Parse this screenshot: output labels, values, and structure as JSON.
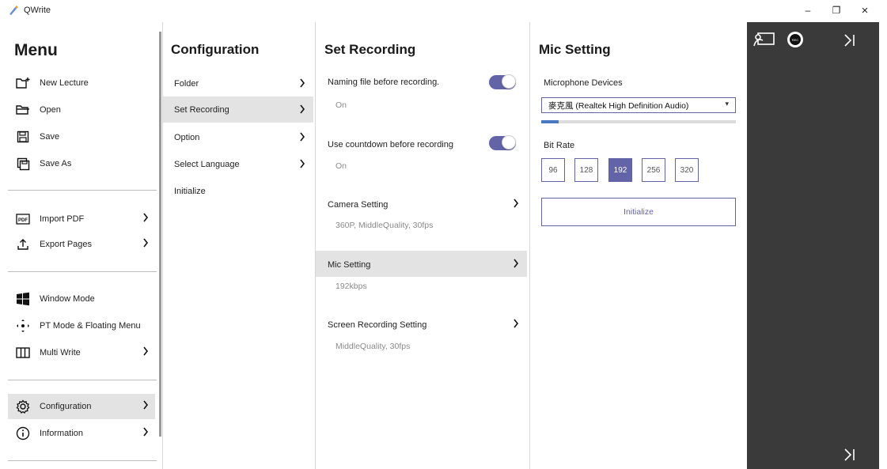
{
  "window": {
    "title": "QWrite",
    "controls": {
      "minimize": "–",
      "restore": "❐",
      "close": "×"
    }
  },
  "menu": {
    "heading": "Menu",
    "items": [
      {
        "label": "New Lecture",
        "icon": "new-lecture-icon"
      },
      {
        "label": "Open",
        "icon": "folder-open-icon"
      },
      {
        "label": "Save",
        "icon": "save-icon"
      },
      {
        "label": "Save As",
        "icon": "save-as-icon"
      },
      {
        "label": "Import PDF",
        "icon": "pdf-icon",
        "chevron": true
      },
      {
        "label": "Export Pages",
        "icon": "export-icon",
        "chevron": true
      },
      {
        "label": "Window Mode",
        "icon": "windows-icon"
      },
      {
        "label": "PT Mode & Floating Menu",
        "icon": "pt-mode-icon"
      },
      {
        "label": "Multi Write",
        "icon": "multi-write-icon",
        "chevron": true
      },
      {
        "label": "Configuration",
        "icon": "gear-icon",
        "chevron": true,
        "active": true
      },
      {
        "label": "Information",
        "icon": "info-icon",
        "chevron": true
      }
    ]
  },
  "configuration": {
    "heading": "Configuration",
    "items": [
      {
        "label": "Folder",
        "chevron": true
      },
      {
        "label": "Set Recording",
        "chevron": true,
        "active": true
      },
      {
        "label": "Option",
        "chevron": true
      },
      {
        "label": "Select Language",
        "chevron": true
      },
      {
        "label": "Initialize",
        "chevron": false
      }
    ]
  },
  "set_recording": {
    "heading": "Set Recording",
    "naming_file": {
      "label": "Naming file before recording.",
      "value": "On",
      "enabled": true
    },
    "countdown": {
      "label": "Use countdown before recording",
      "value": "On",
      "enabled": true
    },
    "camera": {
      "label": "Camera Setting",
      "value": "360P, MiddleQuality, 30fps"
    },
    "mic": {
      "label": "Mic Setting",
      "value": "192kbps"
    },
    "screen": {
      "label": "Screen Recording Setting",
      "value": "MiddleQuality, 30fps"
    }
  },
  "mic_setting": {
    "heading": "Mic Setting",
    "devices_label": "Microphone Devices",
    "device_selected": "麥克風 (Realtek High Definition Audio)",
    "level": 0.09,
    "bitrate_label": "Bit Rate",
    "bitrates": [
      "96",
      "128",
      "192",
      "256",
      "320"
    ],
    "bitrate_selected": "192",
    "initialize_label": "Initialize"
  },
  "colors": {
    "accent": "#6264a7",
    "active_row": "#e3e3e3",
    "dark_panel": "#3a3a3a",
    "meter": "#4a78c2"
  }
}
